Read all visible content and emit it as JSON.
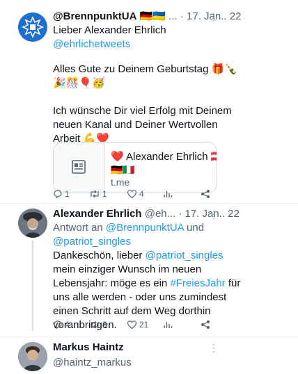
{
  "tweets": [
    {
      "display_name": "@BrennpunktUA",
      "flags": "🇩🇪🇺🇦",
      "handle": "...",
      "date": "· 17. Jan.. 22",
      "reply_to_line": "Lieber Alexander Ehrlich",
      "mention": "@ehrlichetweets",
      "body": [
        "Alles Gute zu Deinem Geburtstag 🎁🍾",
        "🎉🎊🎈🥳",
        "",
        "Ich wünsche Dir viel Erfolg mit Deinem",
        "neuen Kanal und Deiner Wertvollen",
        "Arbeit 💪❤️"
      ],
      "card": {
        "title": "❤️ Alexander Ehrlich 🇦🇹",
        "title2": "🇩🇪🇮🇹",
        "domain": "t.me",
        "icon": "article-icon"
      },
      "actions": {
        "replies": "1",
        "retweets": "1",
        "likes": "4",
        "views": ""
      }
    },
    {
      "display_name": "Alexander Ehrlich",
      "handle": "@eh...",
      "date": "· 17. Jan.. 22",
      "reply_prefix": "Antwort an",
      "reply_mention1": "@BrennpunktUA",
      "reply_and": "und",
      "reply_mention2": "@patriot_singles",
      "body_line1_pre": "Dankeschön, lieber",
      "body_line1_mention": "@patriot_singles",
      "body_line2": "mein einziger Wunsch im neuen",
      "body_line3_pre": "Lebensjahr: möge es ein",
      "body_line3_hashtag": "#FreiesJahr",
      "body_line3_post": "für",
      "body_line4": "uns alle werden - oder uns zumindest",
      "body_line5": "einen Schritt auf dem Weg dorthin",
      "body_line6": "voranbringen.",
      "actions": {
        "replies": "4",
        "retweets": "3",
        "likes": "21",
        "views": ""
      }
    },
    {
      "display_name": "Markus Haintz",
      "handle": "@haintz_markus"
    }
  ],
  "icons": {
    "more": "more-icon",
    "reply": "reply-icon",
    "retweet": "retweet-icon",
    "like": "like-icon",
    "views": "views-icon",
    "share": "share-icon"
  },
  "colors": {
    "link": "#1d9bf0",
    "text": "#0f1419",
    "muted": "#536471",
    "border": "#cfd9de"
  }
}
